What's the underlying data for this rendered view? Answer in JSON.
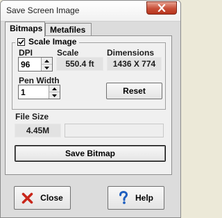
{
  "window": {
    "title": "Save Screen Image"
  },
  "tabs": [
    {
      "label": "Bitmaps",
      "active": true
    },
    {
      "label": "Metafiles",
      "active": false
    }
  ],
  "scale_group": {
    "label": "Scale Image",
    "checked": true,
    "dpi_label": "DPI",
    "dpi_value": "96",
    "scale_label": "Scale",
    "scale_value": "550.4 ft",
    "dimensions_label": "Dimensions",
    "dimensions_value": "1436 X 774",
    "pen_width_label": "Pen Width",
    "pen_width_value": "1",
    "reset_label": "Reset"
  },
  "file_size": {
    "label": "File Size",
    "value": "4.45M",
    "extra": ""
  },
  "save_bitmap_label": "Save Bitmap",
  "close_label": "Close",
  "help_label": "Help",
  "icons": {
    "close_x_color": "#c8261a",
    "help_color": "#1f5fbf",
    "titlebar_close_color": "#c84f38"
  }
}
